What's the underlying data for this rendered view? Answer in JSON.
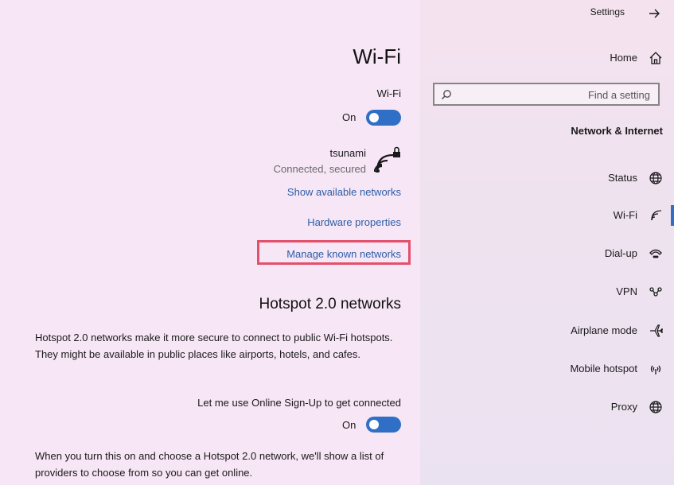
{
  "main": {
    "title": "Wi-Fi",
    "wifi_label": "Wi-Fi",
    "wifi_toggle_state": "On",
    "network": {
      "name": "tsunami",
      "status": "Connected, secured"
    },
    "links": {
      "show_available": "Show available networks",
      "hardware_properties": "Hardware properties",
      "manage_known": "Manage known networks"
    },
    "hotspot": {
      "title": "Hotspot 2.0 networks",
      "description": "Hotspot 2.0 networks make it more secure to connect to public Wi-Fi hotspots. They might be available in public places like airports, hotels, and cafes.",
      "signup_label": "Let me use Online Sign-Up to get connected",
      "signup_toggle_state": "On",
      "footer": "When you turn this on and choose a Hotspot 2.0 network, we'll show a list of providers to choose from so you can get online."
    }
  },
  "sidebar": {
    "back_label": "Settings",
    "home_label": "Home",
    "search_placeholder": "Find a setting",
    "section": "Network & Internet",
    "items": [
      {
        "label": "Status",
        "icon": "globe-icon"
      },
      {
        "label": "Wi-Fi",
        "icon": "wifi-icon"
      },
      {
        "label": "Dial-up",
        "icon": "dialup-icon"
      },
      {
        "label": "VPN",
        "icon": "vpn-icon"
      },
      {
        "label": "Airplane mode",
        "icon": "airplane-icon"
      },
      {
        "label": "Mobile hotspot",
        "icon": "hotspot-icon"
      },
      {
        "label": "Proxy",
        "icon": "globe-icon"
      }
    ]
  },
  "colors": {
    "accent": "#2f6fc6",
    "highlight": "#e2506b",
    "link": "#2a5ea8"
  }
}
